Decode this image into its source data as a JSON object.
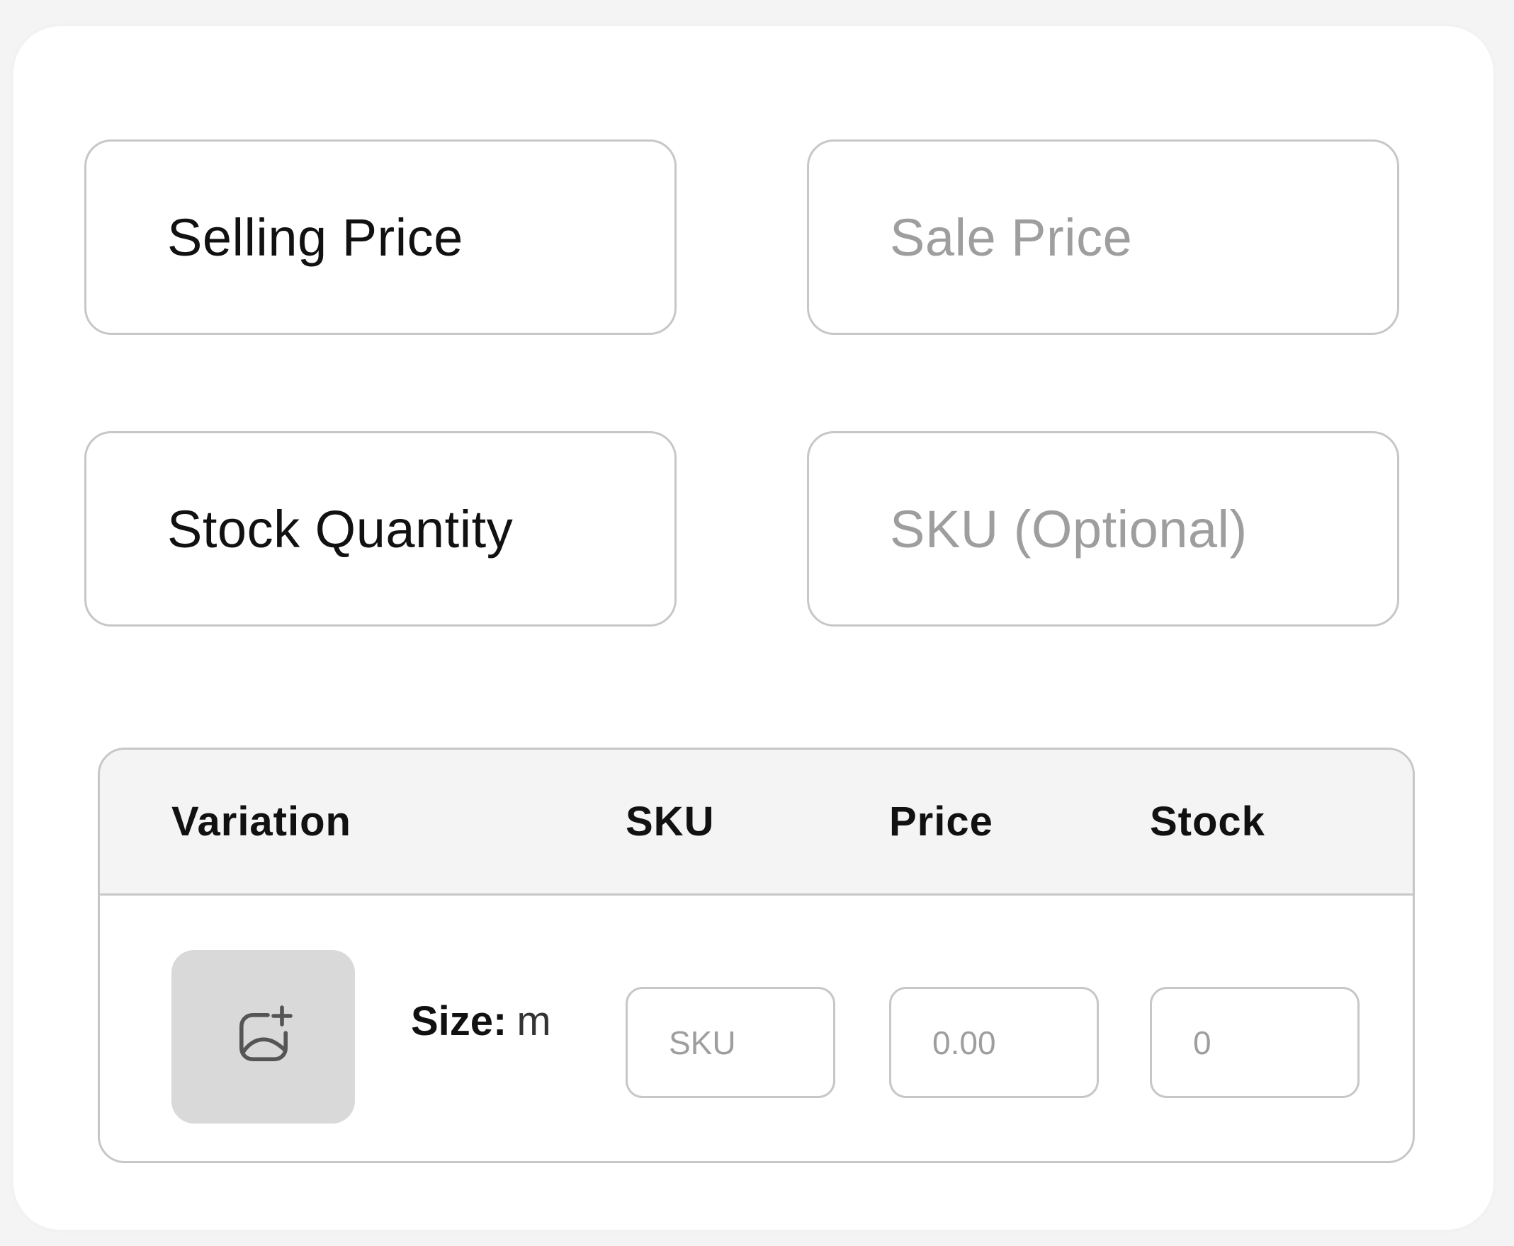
{
  "form": {
    "selling_price": {
      "label": "Selling Price"
    },
    "sale_price": {
      "placeholder": "Sale Price"
    },
    "stock_quantity": {
      "label": "Stock Quantity"
    },
    "sku": {
      "placeholder": "SKU (Optional)"
    }
  },
  "variations": {
    "headers": {
      "variation": "Variation",
      "sku": "SKU",
      "price": "Price",
      "stock": "Stock"
    },
    "rows": [
      {
        "attribute_label": "Size:",
        "attribute_value": "m",
        "image_icon": "add-image-icon",
        "sku_placeholder": "SKU",
        "price_placeholder": "0.00",
        "stock_placeholder": "0"
      }
    ]
  },
  "colors": {
    "border": "#c7c7c7",
    "header_bg": "#f4f4f4",
    "image_slot_bg": "#d9d9d9",
    "placeholder_text": "#9e9e9e"
  }
}
